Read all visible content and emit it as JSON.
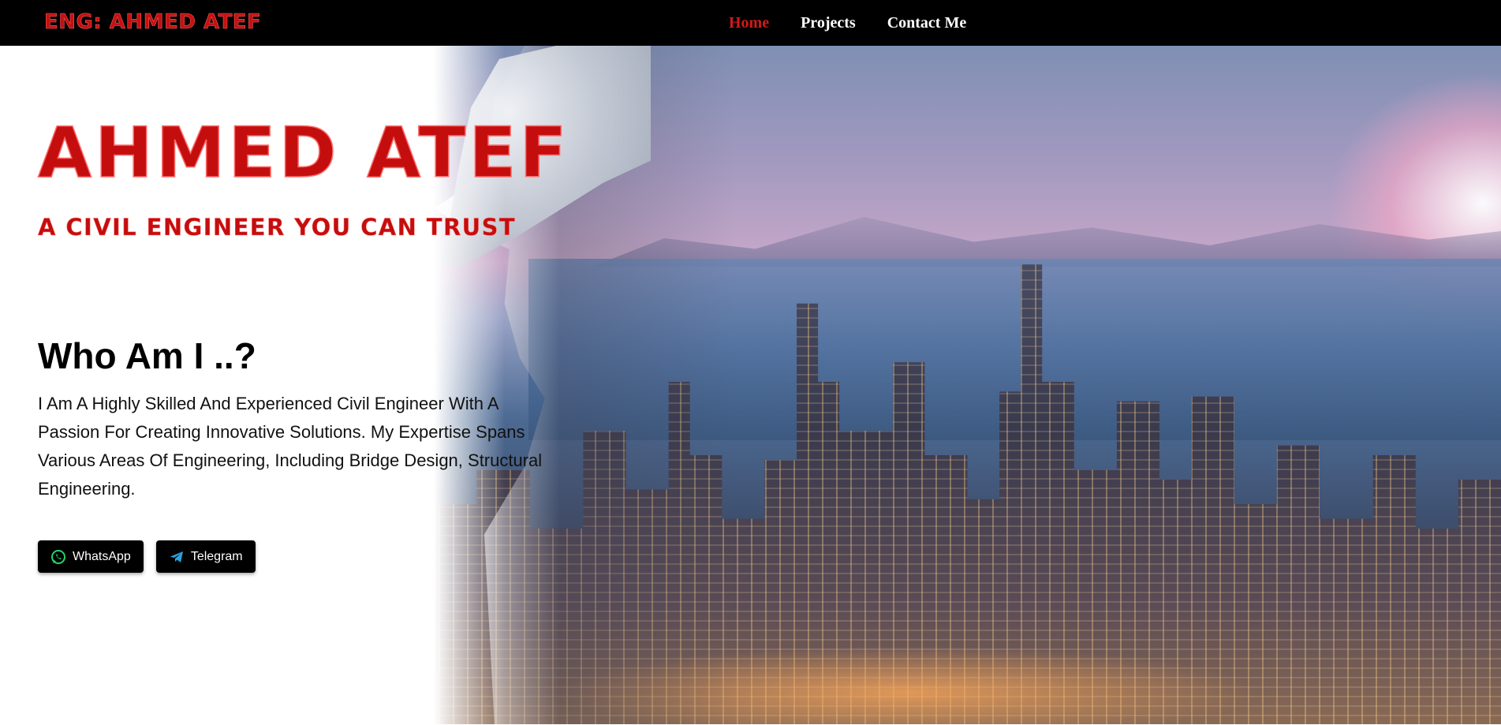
{
  "navbar": {
    "brand": "ENG: AHMED ATEF",
    "links": [
      {
        "label": "Home",
        "active": true
      },
      {
        "label": "Projects",
        "active": false
      },
      {
        "label": "Contact Me",
        "active": false
      }
    ]
  },
  "hero": {
    "title": "AHMED ATEF",
    "subtitle": "A CIVIL ENGINEER YOU CAN TRUST",
    "about_heading": "Who Am I ..?",
    "about_text": "I Am A Highly Skilled And Experienced Civil Engineer With A Passion For Creating Innovative Solutions. My Expertise Spans Various Areas Of Engineering, Including Bridge Design, Structural Engineering.",
    "buttons": [
      {
        "label": "WhatsApp",
        "icon": "whatsapp-icon"
      },
      {
        "label": "Telegram",
        "icon": "telegram-icon"
      }
    ],
    "image": "engineer-city-double-exposure"
  },
  "colors": {
    "accent": "#c40e0e",
    "nav_active": "#d11a1a",
    "navbar_bg": "#000000",
    "whatsapp": "#25d366",
    "telegram": "#2aa3e0"
  }
}
